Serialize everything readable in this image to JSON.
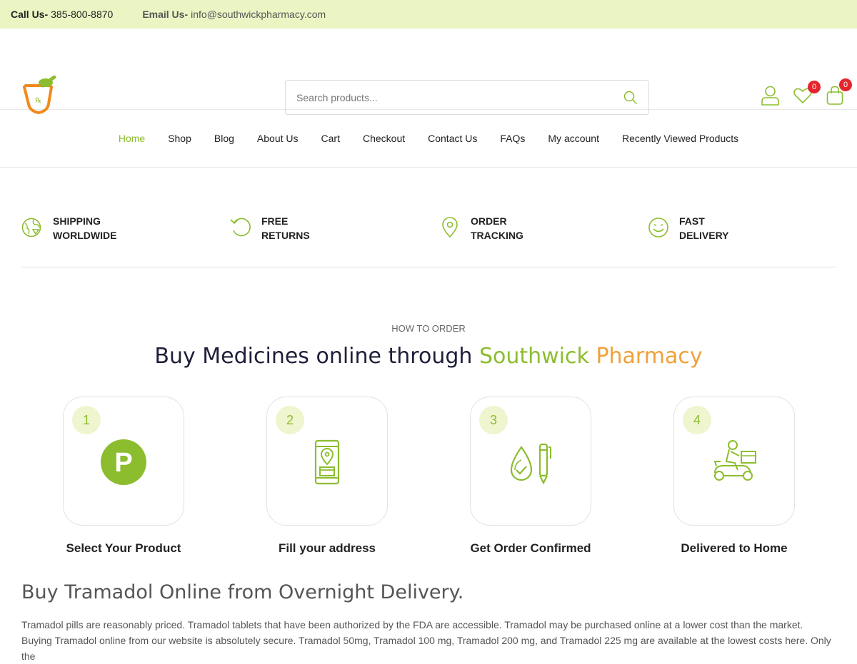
{
  "topbar": {
    "call_label": "Call Us-",
    "call_value": "385-800-8870",
    "email_label": "Email Us-",
    "email_value": "info@southwickpharmacy.com"
  },
  "header": {
    "search_placeholder": "Search products...",
    "wishlist_count": "0",
    "cart_count": "0"
  },
  "nav": {
    "items": [
      "Home",
      "Shop",
      "Blog",
      "About Us",
      "Cart",
      "Checkout",
      "Contact Us",
      "FAQs",
      "My account",
      "Recently Viewed Products"
    ],
    "active": "Home"
  },
  "features": [
    {
      "line1": "SHIPPING",
      "line2": "WORLDWIDE",
      "icon": "globe-icon"
    },
    {
      "line1": "FREE",
      "line2": "RETURNS",
      "icon": "return-icon"
    },
    {
      "line1": "ORDER",
      "line2": "TRACKING",
      "icon": "location-pin-icon"
    },
    {
      "line1": "FAST",
      "line2": "DELIVERY",
      "icon": "smiley-icon"
    }
  ],
  "how": {
    "kicker": "HOW TO ORDER",
    "title_prefix": "Buy Medicines online through",
    "title_green": "Southwick",
    "title_orange": "Pharmacy"
  },
  "steps": [
    {
      "num": "1",
      "label": "Select Your Product",
      "icon": "parking-p-icon"
    },
    {
      "num": "2",
      "label": "Fill your address",
      "icon": "phone-store-icon"
    },
    {
      "num": "3",
      "label": "Get Order Confirmed",
      "icon": "drop-pen-icon"
    },
    {
      "num": "4",
      "label": "Delivered to Home",
      "icon": "scooter-delivery-icon"
    }
  ],
  "article": {
    "heading": "Buy Tramadol Online from Overnight Delivery.",
    "text": "Tramadol pills are reasonably priced. Tramadol tablets that have been authorized by the FDA are accessible. Tramadol may be purchased online at a lower cost than the market. Buying Tramadol online from our website is absolutely secure. Tramadol 50mg, Tramadol 100 mg, Tramadol 200 mg, and Tramadol 225 mg are available at the lowest costs here. Only the"
  },
  "colors": {
    "accent_green": "#8cbd2e",
    "accent_orange": "#f0a13a",
    "topbar_bg": "#ebf5c4",
    "badge_red": "#e4252c"
  }
}
